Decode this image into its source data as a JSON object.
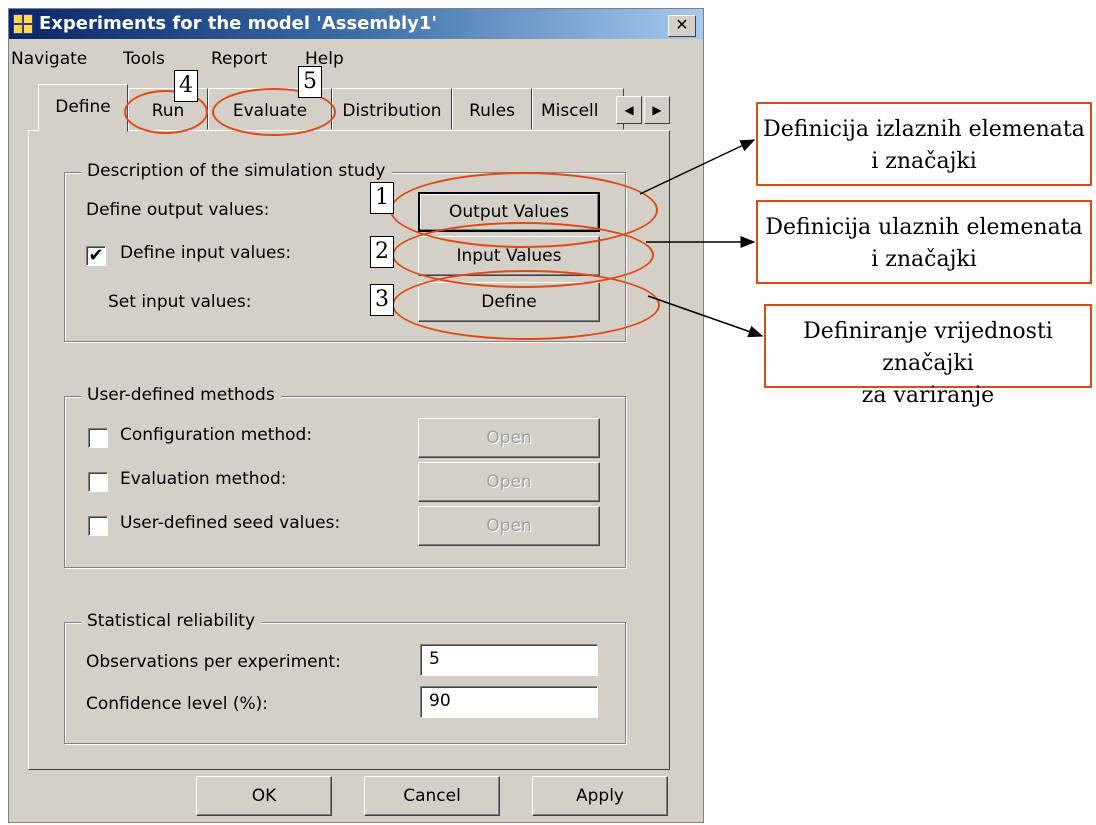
{
  "window": {
    "title": "Experiments for the model 'Assembly1'",
    "close_icon": "✕"
  },
  "menu": [
    "Navigate",
    "Tools",
    "Report",
    "Help"
  ],
  "tabs": [
    {
      "label": "Define",
      "active": true
    },
    {
      "label": "Run"
    },
    {
      "label": "Evaluate"
    },
    {
      "label": "Distribution"
    },
    {
      "label": "Rules"
    },
    {
      "label": "Miscell"
    }
  ],
  "tab_scroll": {
    "left": "◀",
    "right": "▶"
  },
  "groups": {
    "description": {
      "legend": "Description of the simulation study",
      "output_label": "Define output values:",
      "output_button": "Output Values",
      "input_label": "Define input values:",
      "input_checked": true,
      "input_button": "Input Values",
      "set_label": "Set input values:",
      "set_button": "Define"
    },
    "methods": {
      "legend": "User-defined methods",
      "items": [
        {
          "label": "Configuration method:",
          "checked": false,
          "button": "Open"
        },
        {
          "label": "Evaluation method:",
          "checked": false,
          "button": "Open"
        },
        {
          "label": "User-defined seed values:",
          "checked": false,
          "button": "Open"
        }
      ]
    },
    "reliability": {
      "legend": "Statistical reliability",
      "observations_label": "Observations per experiment:",
      "observations_value": "5",
      "confidence_label": "Confidence level (%):",
      "confidence_value": "90"
    }
  },
  "footer": {
    "ok": "OK",
    "cancel": "Cancel",
    "apply": "Apply"
  },
  "annotations": {
    "markers": [
      "1",
      "2",
      "3",
      "4",
      "5"
    ],
    "callouts": [
      "Definicija izlaznih elemenata i značajki",
      "Definicija ulaznih elemenata i značajki",
      "Definiranje vrijednosti značajki za variranje"
    ],
    "color": "#e04818"
  },
  "colors": {
    "face": "#d4d0c8",
    "title_start": "#0a246a",
    "title_end": "#a6caf0"
  }
}
